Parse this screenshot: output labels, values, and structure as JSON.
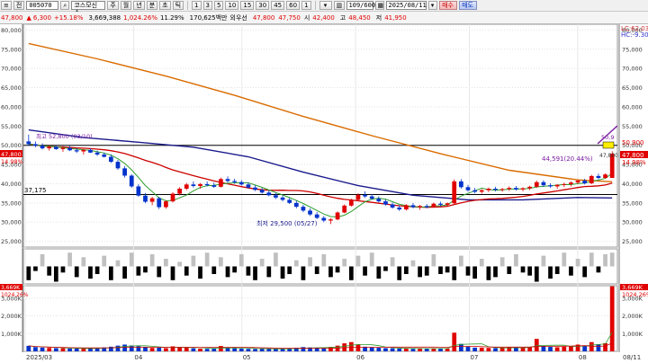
{
  "toolbar": {
    "menu_icon": "menu-icon",
    "market_label": "전",
    "stock_code": "005070",
    "search_icon": "search-icon",
    "stock_name": "코스모신소",
    "period_buttons": [
      "주",
      "월",
      "년",
      "분",
      "초",
      "틱"
    ],
    "interval_buttons": [
      "1",
      "3",
      "5",
      "10",
      "15",
      "30",
      "45",
      "60",
      "1"
    ],
    "count": "109/600",
    "date": "2025/08/11",
    "buy_label": "매수",
    "sell_label": "매도"
  },
  "quote": {
    "price": "47,800",
    "change": "6,300",
    "change_rate": "+15.18%",
    "volume": "3,669,388",
    "volume_ratio": "1,024.26%",
    "turnover": "11.29%",
    "amount": "170,625백만",
    "investor": "외우선",
    "bid": "47,800",
    "ask": "47,750",
    "open_label": "시",
    "open": "42,400",
    "high_label": "고",
    "high": "48,450",
    "low_label": "저",
    "low": "41,950"
  },
  "price_axis": {
    "ticks": [
      "80,000",
      "75,000",
      "70,000",
      "65,000",
      "60,000",
      "55,000",
      "50,000",
      "45,000",
      "40,000",
      "35,000",
      "30,000",
      "25,000"
    ],
    "right_ticks": [
      "80,000",
      "75,000",
      "70,000",
      "65,000",
      "60,000",
      "55,000",
      "50,000",
      "45,000",
      "40,000",
      "35,000",
      "30,000",
      "25,000"
    ],
    "lc_label": "LC:62.03",
    "hc_label": "HC:-9.30",
    "current_price": "47,800",
    "current_rate": "14.98%",
    "ref_price": "50,900",
    "ref_rate": "20.45%"
  },
  "annotations": {
    "support_label": "37,175",
    "low_label": "최저 29,500 (05/27)",
    "high_label_left": "최고 52,800 (03/10)",
    "target_label": "44,591(20.44%)",
    "peak_label": "50,9",
    "cur_small": "47,800",
    "left_price": "47,800",
    "left_rate": "14.98%"
  },
  "volume_axis": {
    "ticks": [
      "3,000K",
      "2,000K",
      "1,000K"
    ],
    "right_ticks": [
      "3,000K",
      "2,000K",
      "1,000K"
    ],
    "current": "3,669K",
    "current_rate": "1024.26%",
    "left_current": "3,669K",
    "left_rate": "1024.26%"
  },
  "date_axis": {
    "labels": [
      "2025/03",
      "04",
      "05",
      "06",
      "07",
      "08"
    ],
    "right_label": "08/11"
  },
  "colors": {
    "up": "#e00000",
    "down": "#0033cc",
    "ma5": "#2e9e2e",
    "ma20": "#cc0000",
    "ma60": "#1a1a8c",
    "ma120": "#d96b00",
    "osc_pos": "#c0c0c0",
    "osc_neg": "#000000"
  },
  "chart_data": {
    "type": "candlestick",
    "x_range": [
      "2025/03",
      "2025/08/11"
    ],
    "ylim": [
      25000,
      80000
    ],
    "volume_ylim": [
      0,
      3700000
    ],
    "ohlc": [
      [
        51000,
        52800,
        49800,
        50300
      ],
      [
        50300,
        51000,
        49500,
        49900
      ],
      [
        49900,
        50500,
        48900,
        49200
      ],
      [
        49200,
        50000,
        48600,
        49600
      ],
      [
        49600,
        50000,
        48800,
        49000
      ],
      [
        49000,
        49800,
        48300,
        49300
      ],
      [
        49300,
        49800,
        48500,
        48700
      ],
      [
        48700,
        49300,
        48000,
        48400
      ],
      [
        48400,
        49000,
        47600,
        48800
      ],
      [
        48800,
        49200,
        48000,
        48100
      ],
      [
        48100,
        48600,
        47200,
        47600
      ],
      [
        47600,
        48100,
        46800,
        47000
      ],
      [
        47000,
        47600,
        45400,
        45700
      ],
      [
        45700,
        46200,
        43600,
        44000
      ],
      [
        44000,
        44600,
        41600,
        42100
      ],
      [
        42100,
        42500,
        38900,
        39300
      ],
      [
        39300,
        39900,
        36600,
        36900
      ],
      [
        36900,
        37600,
        34900,
        35300
      ],
      [
        35300,
        36600,
        34400,
        36200
      ],
      [
        36200,
        36600,
        33400,
        33900
      ],
      [
        33900,
        35700,
        33500,
        35400
      ],
      [
        35400,
        37800,
        35100,
        37400
      ],
      [
        37400,
        39100,
        37000,
        38700
      ],
      [
        38700,
        40200,
        38300,
        39800
      ],
      [
        39800,
        40600,
        39000,
        39400
      ],
      [
        39400,
        40200,
        38700,
        39900
      ],
      [
        39900,
        40600,
        39300,
        39600
      ],
      [
        39600,
        40300,
        38900,
        39200
      ],
      [
        39200,
        41600,
        39000,
        41200
      ],
      [
        41200,
        41900,
        40300,
        40700
      ],
      [
        40700,
        41300,
        40000,
        40400
      ],
      [
        40400,
        40900,
        39500,
        39800
      ],
      [
        39800,
        40300,
        38700,
        39000
      ],
      [
        39000,
        39600,
        38100,
        38400
      ],
      [
        38400,
        38900,
        37400,
        37700
      ],
      [
        37700,
        38200,
        36700,
        37000
      ],
      [
        37000,
        37600,
        36000,
        36400
      ],
      [
        36400,
        36900,
        35400,
        35800
      ],
      [
        35800,
        36300,
        34700,
        35000
      ],
      [
        35000,
        35600,
        33600,
        34000
      ],
      [
        34000,
        34500,
        32600,
        33000
      ],
      [
        33000,
        33600,
        31600,
        32000
      ],
      [
        32000,
        32600,
        30800,
        31100
      ],
      [
        31100,
        31600,
        30000,
        30400
      ],
      [
        30400,
        31000,
        29500,
        30700
      ],
      [
        30700,
        32800,
        30500,
        32500
      ],
      [
        32500,
        34600,
        32300,
        34300
      ],
      [
        34300,
        36100,
        34000,
        35800
      ],
      [
        35800,
        37500,
        35500,
        37100
      ],
      [
        37100,
        38000,
        36300,
        36700
      ],
      [
        36700,
        37300,
        35800,
        36100
      ],
      [
        36100,
        36700,
        35100,
        35400
      ],
      [
        35400,
        35900,
        34300,
        34600
      ],
      [
        34600,
        35100,
        33500,
        33800
      ],
      [
        33800,
        34400,
        32900,
        33300
      ],
      [
        33300,
        34700,
        33000,
        34400
      ],
      [
        34400,
        35000,
        33600,
        33900
      ],
      [
        33900,
        34500,
        33200,
        34200
      ],
      [
        34200,
        34700,
        33600,
        33900
      ],
      [
        33900,
        35100,
        33700,
        34800
      ],
      [
        34800,
        35300,
        34100,
        34500
      ],
      [
        34500,
        35100,
        34000,
        34900
      ],
      [
        34900,
        41100,
        34700,
        40600
      ],
      [
        40600,
        41200,
        38700,
        39100
      ],
      [
        39100,
        39700,
        37900,
        38300
      ],
      [
        38300,
        38900,
        37500,
        37900
      ],
      [
        37900,
        38600,
        37400,
        38300
      ],
      [
        38300,
        39000,
        37800,
        38700
      ],
      [
        38700,
        39200,
        38000,
        38400
      ],
      [
        38400,
        38900,
        37900,
        38600
      ],
      [
        38600,
        39300,
        38100,
        38900
      ],
      [
        38900,
        39400,
        38200,
        38500
      ],
      [
        38500,
        39100,
        38000,
        38800
      ],
      [
        38800,
        39500,
        38300,
        39200
      ],
      [
        39200,
        40800,
        38900,
        40400
      ],
      [
        40400,
        40900,
        39200,
        39600
      ],
      [
        39600,
        40100,
        38900,
        39300
      ],
      [
        39300,
        39900,
        38700,
        39700
      ],
      [
        39700,
        40300,
        39100,
        39900
      ],
      [
        39900,
        40600,
        39300,
        40300
      ],
      [
        40300,
        41100,
        39900,
        40800
      ],
      [
        40800,
        41300,
        39800,
        40100
      ],
      [
        40100,
        42300,
        39900,
        42000
      ],
      [
        42000,
        42600,
        41200,
        41500
      ],
      [
        41500,
        42700,
        41300,
        42400
      ],
      [
        41500,
        48450,
        41950,
        47800
      ]
    ],
    "volume": [
      310000,
      240000,
      210000,
      190000,
      180000,
      170000,
      160000,
      160000,
      150000,
      170000,
      200000,
      220000,
      260000,
      320000,
      380000,
      330000,
      290000,
      240000,
      190000,
      210000,
      180000,
      280000,
      240000,
      200000,
      170000,
      150000,
      140000,
      160000,
      300000,
      200000,
      170000,
      150000,
      140000,
      130000,
      160000,
      150000,
      140000,
      130000,
      150000,
      200000,
      240000,
      220000,
      200000,
      190000,
      250000,
      320000,
      450000,
      520000,
      380000,
      260000,
      230000,
      200000,
      180000,
      170000,
      160000,
      150000,
      140000,
      160000,
      150000,
      170000,
      160000,
      150000,
      1050000,
      420000,
      260000,
      210000,
      200000,
      190000,
      180000,
      200000,
      230000,
      210000,
      200000,
      250000,
      700000,
      300000,
      250000,
      230000,
      260000,
      300000,
      380000,
      320000,
      520000,
      400000,
      460000,
      3669388
    ],
    "oscillator": [
      -0.9,
      -0.3,
      0.8,
      -0.6,
      -1.0,
      -0.4,
      0.9,
      -0.7,
      0.6,
      -0.8,
      -0.5,
      0.7,
      -0.9,
      0.4,
      -0.8,
      0.9,
      -0.6,
      -0.4,
      0.8,
      -0.7,
      0.5,
      -0.9,
      0.3,
      -0.6,
      0.7,
      -0.8,
      0.9,
      -0.5,
      0.6,
      -0.7,
      -0.4,
      0.8,
      -0.6,
      -0.9,
      0.5,
      -0.7,
      0.9,
      -0.8,
      -0.5,
      0.4,
      -0.9,
      0.6,
      -0.5,
      0.8,
      -0.7,
      -0.4,
      0.5,
      -0.9,
      0.7,
      -0.6,
      0.9,
      -0.8,
      -0.3,
      0.6,
      -0.9,
      -0.5,
      0.4,
      -0.7,
      -0.6,
      0.8,
      -0.5,
      -0.4,
      -0.9,
      0.7,
      -0.6,
      -0.8,
      0.5,
      -0.9,
      -0.7,
      0.6,
      -0.5,
      0.8,
      -0.4,
      -0.6,
      -1.0,
      0.7,
      -0.8,
      -0.5,
      0.9,
      -0.6,
      0.5,
      -0.7,
      0.9,
      -0.4,
      0.8,
      0.9
    ],
    "ma120": [
      [
        0,
        76500
      ],
      [
        10,
        72500
      ],
      [
        20,
        68000
      ],
      [
        30,
        63000
      ],
      [
        40,
        57500
      ],
      [
        50,
        52500
      ],
      [
        60,
        47800
      ],
      [
        70,
        43500
      ],
      [
        80,
        41000
      ],
      [
        85,
        40500
      ]
    ],
    "ma60": [
      [
        0,
        54000
      ],
      [
        8,
        52000
      ],
      [
        16,
        50800
      ],
      [
        24,
        49500
      ],
      [
        32,
        47000
      ],
      [
        40,
        43000
      ],
      [
        48,
        39500
      ],
      [
        56,
        37000
      ],
      [
        64,
        35800
      ],
      [
        72,
        35800
      ],
      [
        80,
        36400
      ],
      [
        85,
        36300
      ]
    ],
    "reference_lines": [
      50000,
      37175
    ],
    "title": "",
    "xlabel": "",
    "ylabel": ""
  }
}
